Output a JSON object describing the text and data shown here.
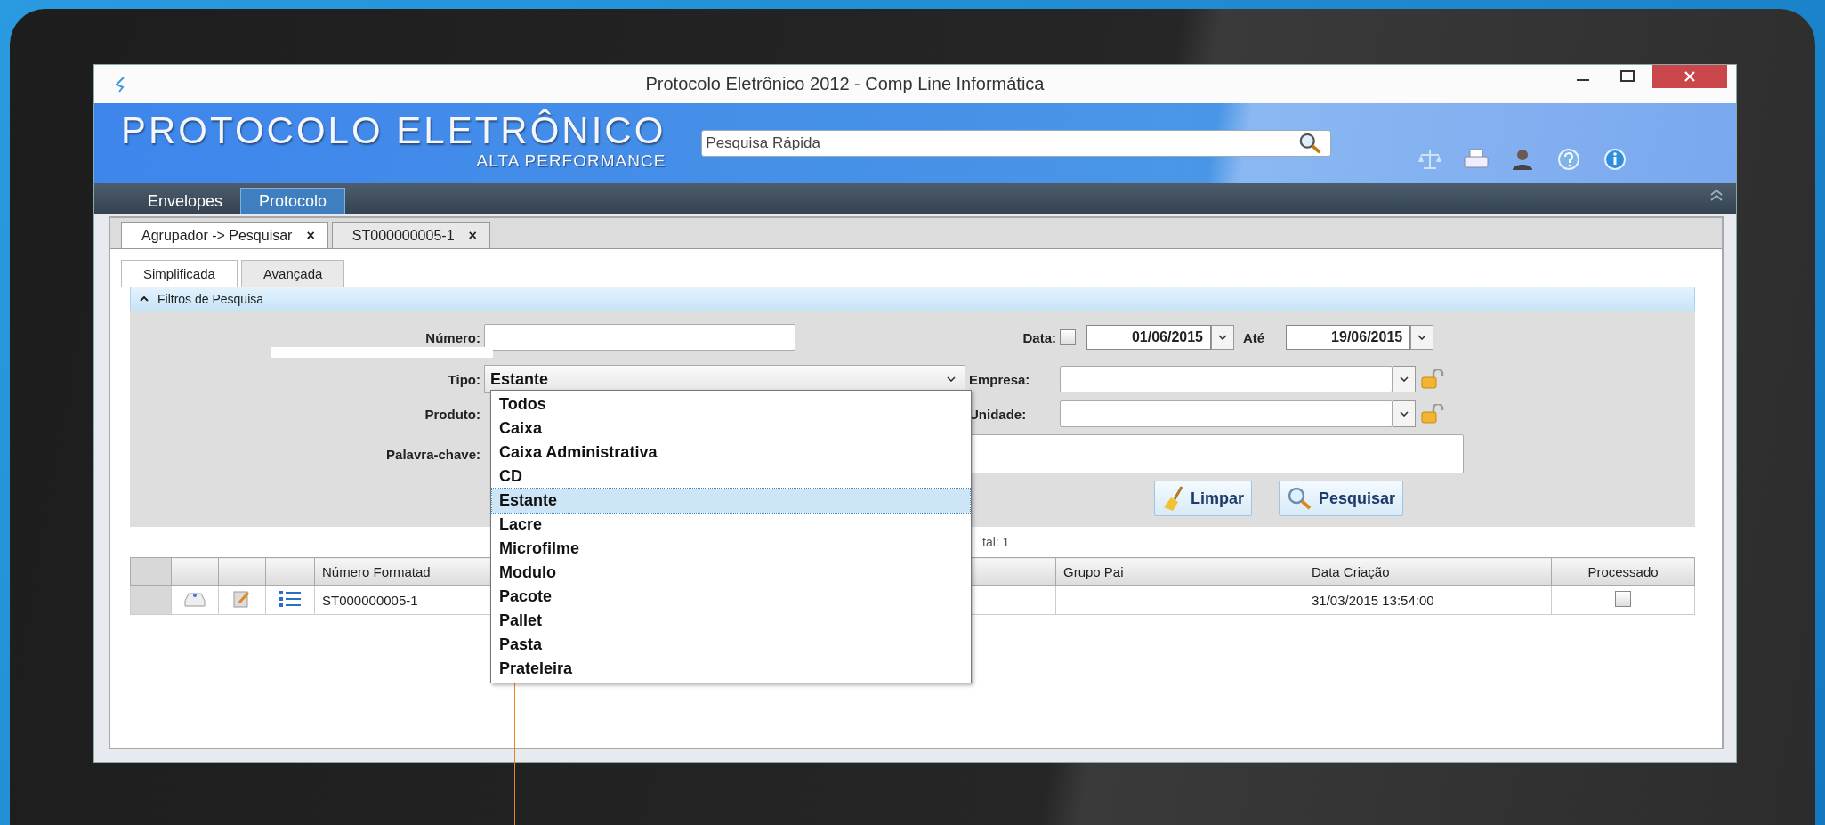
{
  "window": {
    "title": "Protocolo Eletrônico 2012 - Comp Line Informática"
  },
  "header": {
    "title": "PROTOCOLO ELETRÔNICO",
    "subtitle": "ALTA PERFORMANCE",
    "search": {
      "placeholder": "Pesquisa Rápida"
    }
  },
  "nav_tabs": [
    {
      "label": "Envelopes",
      "selected": false
    },
    {
      "label": "Protocolo",
      "selected": true
    }
  ],
  "doc_tabs": [
    {
      "label": "Agrupador -> Pesquisar",
      "close": "×",
      "selected": true
    },
    {
      "label": "ST000000005-1",
      "close": "×",
      "selected": false
    }
  ],
  "sub_tabs": [
    {
      "label": "Simplificada",
      "selected": true
    },
    {
      "label": "Avançada",
      "selected": false
    }
  ],
  "filters": {
    "title": "Filtros de Pesquisa",
    "expanded": true,
    "numero_label": "Número:",
    "tipo_label": "Tipo:",
    "tipo_value": "Estante",
    "produto_label": "Produto:",
    "palavra_label": "Palavra-chave:",
    "data_label": "Data:",
    "data_checked": false,
    "date_from": "01/06/2015",
    "ate_label": "Até",
    "date_to": "19/06/2015",
    "empresa_label": "Empresa:",
    "unidade_label": "Unidade:",
    "buttons": [
      {
        "label": "Limpar",
        "kind": "clear"
      },
      {
        "label": "Pesquisar",
        "kind": "search"
      }
    ]
  },
  "dropdown": {
    "open": true,
    "items": [
      {
        "label": "Todos",
        "selected": false
      },
      {
        "label": "Caixa",
        "selected": false
      },
      {
        "label": "Caixa Administrativa",
        "selected": false
      },
      {
        "label": "CD",
        "selected": false
      },
      {
        "label": "Estante",
        "selected": true
      },
      {
        "label": "Lacre",
        "selected": false
      },
      {
        "label": "Microfilme",
        "selected": false
      },
      {
        "label": "Modulo",
        "selected": false
      },
      {
        "label": "Pacote",
        "selected": false
      },
      {
        "label": "Pallet",
        "selected": false
      },
      {
        "label": "Pasta",
        "selected": false
      },
      {
        "label": "Prateleira",
        "selected": false
      }
    ]
  },
  "results": {
    "total": "tal: 1",
    "columns": [
      "Número Formatad",
      "Grupo Pai",
      "Data Criação",
      "Processado"
    ],
    "rows": [
      {
        "numero": "ST000000005-1",
        "data_criacao": "31/03/2015 13:54:00",
        "processado": false
      }
    ]
  }
}
